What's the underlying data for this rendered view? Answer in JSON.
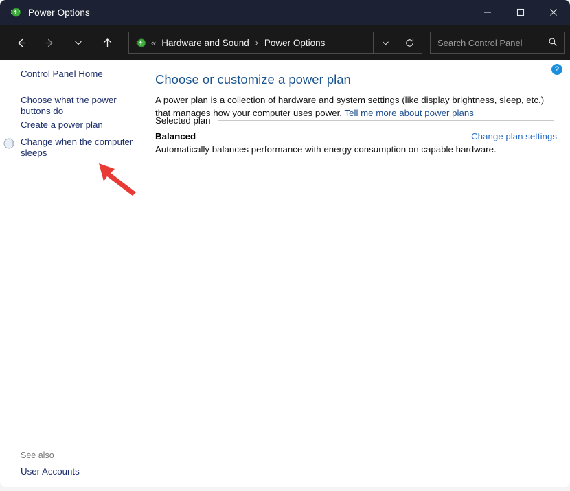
{
  "window": {
    "title": "Power Options",
    "title_icon": "power-plug-icon",
    "controls": {
      "minimize": "—",
      "maximize": "□",
      "close": "✕"
    }
  },
  "toolbar": {
    "back": "back-arrow",
    "forward": "forward-arrow",
    "recent": "chevron-down",
    "up": "up-arrow",
    "address": {
      "icon": "power-plug-icon",
      "overflow": "«",
      "crumbs": [
        "Hardware and Sound",
        "Power Options"
      ],
      "separator": "›",
      "dropdown": "chevron-down-icon",
      "refresh": "refresh-icon"
    },
    "search": {
      "placeholder": "Search Control Panel",
      "value": "",
      "icon": "search-icon"
    }
  },
  "sidebar": {
    "links": [
      {
        "label": "Control Panel Home"
      },
      {
        "label": "Choose what the power buttons do"
      },
      {
        "label": "Create a power plan"
      },
      {
        "label": "Change when the computer sleeps",
        "icon": "sleep-moon-icon"
      }
    ],
    "see_also": {
      "label": "See also",
      "links": [
        "User Accounts"
      ]
    }
  },
  "main": {
    "help": "?",
    "title": "Choose or customize a power plan",
    "description_before": "A power plan is a collection of hardware and system settings (like display brightness, sleep, etc.) that manages how your computer uses power. ",
    "description_link": "Tell me more about power plans",
    "section_label": "Selected plan",
    "plan_name": "Balanced",
    "plan_change_link": "Change plan settings",
    "plan_description": "Automatically balances performance with energy consumption on capable hardware."
  },
  "annotation": {
    "type": "red-arrow",
    "color": "#e83b35",
    "points_at": "Choose what the power buttons do"
  },
  "colors": {
    "titlebar_bg": "#1c2233",
    "toolbar_bg": "#191919",
    "content_bg": "#ffffff",
    "link_navy": "#1b2d6b",
    "link_blue": "#2a6cc4",
    "heading_blue": "#19548f",
    "help_blue": "#1a8fe0",
    "annotation_red": "#e83b35"
  }
}
